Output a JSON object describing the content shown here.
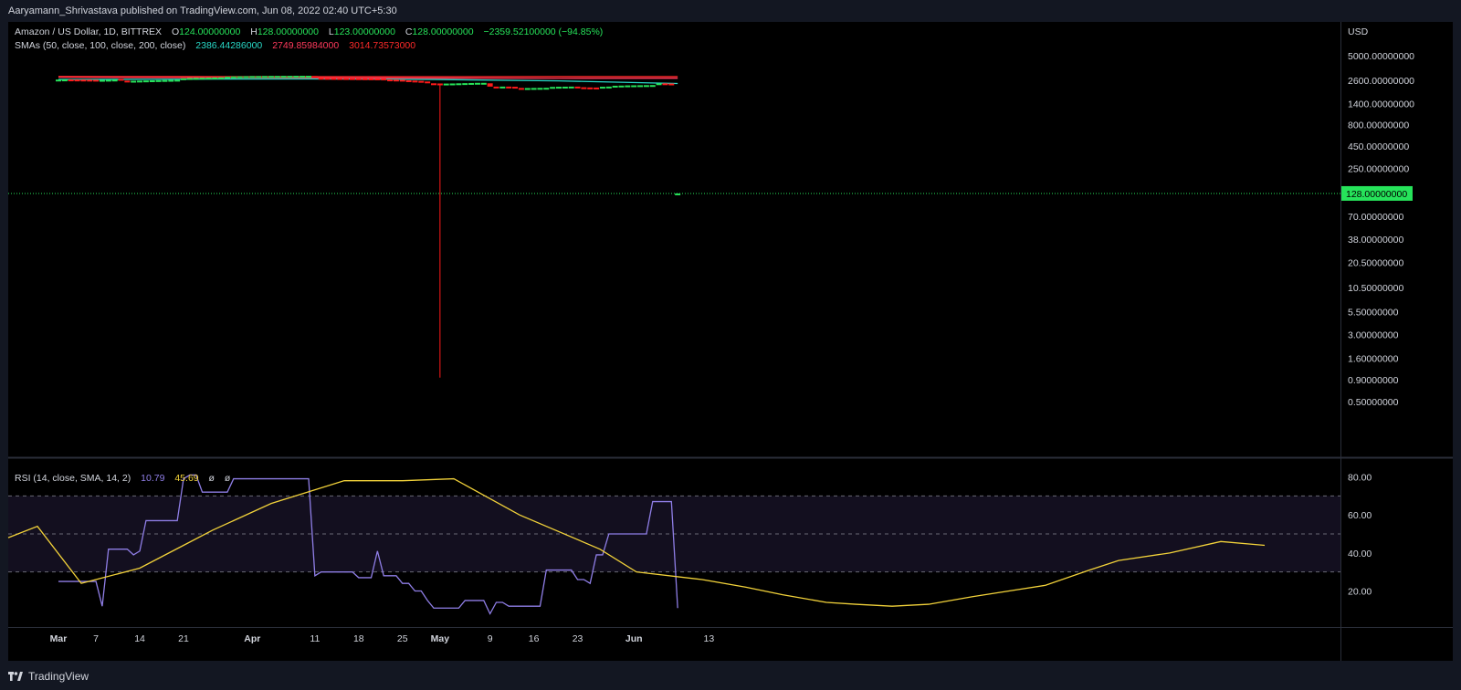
{
  "header": {
    "published": "Aaryamann_Shrivastava published on TradingView.com, Jun 08, 2022 02:40 UTC+5:30"
  },
  "legend": {
    "symbol": "Amazon / US Dollar, 1D, BITTREX",
    "o_label": "O",
    "o_value": "124.00000000",
    "h_label": "H",
    "h_value": "128.00000000",
    "l_label": "L",
    "l_value": "123.00000000",
    "c_label": "C",
    "c_value": "128.00000000",
    "change": "−2359.52100000 (−94.85%)",
    "sma_label": "SMAs (50, close, 100, close, 200, close)",
    "sma50": "2386.44286000",
    "sma100": "2749.85984000",
    "sma200": "3014.73573000",
    "rsi_label": "RSI (14, close, SMA, 14, 2)",
    "rsi_value": "10.79",
    "rsi_ma": "45.69",
    "rsi_x1": "ø",
    "rsi_x2": "ø"
  },
  "footer": {
    "brand": "TradingView"
  },
  "colors": {
    "up": "#26e35a",
    "down": "#ff1a1a",
    "sma50": "#28d9c7",
    "sma100": "#ff3a5c",
    "sma200": "#ff2a2a",
    "rsi": "#8f7ee6",
    "rsi_ma": "#f2d23a"
  },
  "chart_data": [
    {
      "type": "candlestick",
      "scale": "log",
      "currency": "USD",
      "price_ticks": [
        "5000.00000000",
        "2600.00000000",
        "1400.00000000",
        "800.00000000",
        "450.00000000",
        "250.00000000",
        "128.00000000",
        "70.00000000",
        "38.00000000",
        "20.50000000",
        "10.50000000",
        "5.50000000",
        "3.00000000",
        "1.60000000",
        "0.90000000",
        "0.50000000"
      ],
      "last_price": "128.00000000",
      "last_price_value": 128,
      "date_ticks": [
        "Mar",
        "7",
        "14",
        "21",
        "Apr",
        "11",
        "18",
        "25",
        "May",
        "9",
        "16",
        "23",
        "Jun",
        "13"
      ],
      "date_tick_days": [
        0,
        6,
        13,
        20,
        31,
        41,
        48,
        55,
        61,
        69,
        76,
        83,
        92,
        104
      ],
      "candles": [
        {
          "d": 0,
          "o": 2650,
          "c": 2650
        },
        {
          "d": 1,
          "o": 2650,
          "c": 2660
        },
        {
          "d": 2,
          "o": 2660,
          "c": 2655
        },
        {
          "d": 3,
          "o": 2655,
          "c": 2650
        },
        {
          "d": 4,
          "o": 2650,
          "c": 2645
        },
        {
          "d": 5,
          "o": 2645,
          "c": 2640
        },
        {
          "d": 6,
          "o": 2640,
          "c": 2630
        },
        {
          "d": 7,
          "o": 2630,
          "c": 2630
        },
        {
          "d": 8,
          "o": 2630,
          "c": 2640
        },
        {
          "d": 9,
          "o": 2640,
          "c": 2650
        },
        {
          "d": 10,
          "o": 2700,
          "c": 2580
        },
        {
          "d": 11,
          "o": 2580,
          "c": 2560
        },
        {
          "d": 12,
          "o": 2560,
          "c": 2570
        },
        {
          "d": 13,
          "o": 2570,
          "c": 2580
        },
        {
          "d": 14,
          "o": 2580,
          "c": 2590
        },
        {
          "d": 15,
          "o": 2590,
          "c": 2600
        },
        {
          "d": 16,
          "o": 2600,
          "c": 2610
        },
        {
          "d": 17,
          "o": 2610,
          "c": 2620
        },
        {
          "d": 18,
          "o": 2620,
          "c": 2630
        },
        {
          "d": 19,
          "o": 2630,
          "c": 2640
        },
        {
          "d": 20,
          "o": 2650,
          "c": 2740
        },
        {
          "d": 21,
          "o": 2740,
          "c": 2760
        },
        {
          "d": 22,
          "o": 2760,
          "c": 2770
        },
        {
          "d": 23,
          "o": 2770,
          "c": 2780
        },
        {
          "d": 24,
          "o": 2780,
          "c": 2790
        },
        {
          "d": 25,
          "o": 2790,
          "c": 2800
        },
        {
          "d": 26,
          "o": 2800,
          "c": 2810
        },
        {
          "d": 27,
          "o": 2810,
          "c": 2860
        },
        {
          "d": 28,
          "o": 2860,
          "c": 2880
        },
        {
          "d": 29,
          "o": 2880,
          "c": 2890
        },
        {
          "d": 30,
          "o": 2890,
          "c": 2900
        },
        {
          "d": 31,
          "o": 2900,
          "c": 2910
        },
        {
          "d": 32,
          "o": 2910,
          "c": 2910
        },
        {
          "d": 33,
          "o": 2910,
          "c": 2915
        },
        {
          "d": 34,
          "o": 2915,
          "c": 2920
        },
        {
          "d": 35,
          "o": 2920,
          "c": 2920
        },
        {
          "d": 36,
          "o": 2920,
          "c": 2925
        },
        {
          "d": 37,
          "o": 2925,
          "c": 2925
        },
        {
          "d": 38,
          "o": 2925,
          "c": 2930
        },
        {
          "d": 39,
          "o": 2930,
          "c": 2930
        },
        {
          "d": 40,
          "o": 2930,
          "c": 2930
        },
        {
          "d": 41,
          "o": 2920,
          "c": 2780
        },
        {
          "d": 42,
          "o": 2780,
          "c": 2770
        },
        {
          "d": 43,
          "o": 2770,
          "c": 2765
        },
        {
          "d": 44,
          "o": 2765,
          "c": 2760
        },
        {
          "d": 45,
          "o": 2760,
          "c": 2755
        },
        {
          "d": 46,
          "o": 2755,
          "c": 2750
        },
        {
          "d": 47,
          "o": 2750,
          "c": 2745
        },
        {
          "d": 48,
          "o": 2745,
          "c": 2740
        },
        {
          "d": 49,
          "o": 2740,
          "c": 2735
        },
        {
          "d": 50,
          "o": 2735,
          "c": 2730
        },
        {
          "d": 51,
          "o": 2730,
          "c": 2725
        },
        {
          "d": 52,
          "o": 2725,
          "c": 2660
        },
        {
          "d": 53,
          "o": 2660,
          "c": 2650
        },
        {
          "d": 54,
          "o": 2650,
          "c": 2640
        },
        {
          "d": 55,
          "o": 2640,
          "c": 2600
        },
        {
          "d": 56,
          "o": 2600,
          "c": 2580
        },
        {
          "d": 57,
          "o": 2580,
          "c": 2560
        },
        {
          "d": 58,
          "o": 2560,
          "c": 2520
        },
        {
          "d": 59,
          "o": 2520,
          "c": 2400
        },
        {
          "d": 60,
          "o": 2400,
          "c": 2390
        },
        {
          "d": 61,
          "o": 2390,
          "c": 2380,
          "l": 0.95
        },
        {
          "d": 62,
          "o": 2380,
          "c": 2385
        },
        {
          "d": 63,
          "o": 2385,
          "c": 2390
        },
        {
          "d": 64,
          "o": 2390,
          "c": 2400
        },
        {
          "d": 65,
          "o": 2400,
          "c": 2410
        },
        {
          "d": 66,
          "o": 2410,
          "c": 2420
        },
        {
          "d": 67,
          "o": 2420,
          "c": 2430
        },
        {
          "d": 68,
          "o": 2430,
          "c": 2430
        },
        {
          "d": 69,
          "o": 2400,
          "c": 2200
        },
        {
          "d": 70,
          "o": 2200,
          "c": 2190
        },
        {
          "d": 71,
          "o": 2190,
          "c": 2200
        },
        {
          "d": 72,
          "o": 2200,
          "c": 2190
        },
        {
          "d": 73,
          "o": 2190,
          "c": 2120
        },
        {
          "d": 74,
          "o": 2120,
          "c": 2110
        },
        {
          "d": 75,
          "o": 2110,
          "c": 2115
        },
        {
          "d": 76,
          "o": 2115,
          "c": 2120
        },
        {
          "d": 77,
          "o": 2120,
          "c": 2125
        },
        {
          "d": 78,
          "o": 2125,
          "c": 2130
        },
        {
          "d": 79,
          "o": 2130,
          "c": 2180
        },
        {
          "d": 80,
          "o": 2180,
          "c": 2190
        },
        {
          "d": 81,
          "o": 2190,
          "c": 2195
        },
        {
          "d": 82,
          "o": 2195,
          "c": 2200
        },
        {
          "d": 83,
          "o": 2200,
          "c": 2160
        },
        {
          "d": 84,
          "o": 2160,
          "c": 2150
        },
        {
          "d": 85,
          "o": 2150,
          "c": 2145
        },
        {
          "d": 86,
          "o": 2145,
          "c": 2140
        },
        {
          "d": 87,
          "o": 2140,
          "c": 2190
        },
        {
          "d": 88,
          "o": 2190,
          "c": 2200
        },
        {
          "d": 89,
          "o": 2200,
          "c": 2250
        },
        {
          "d": 90,
          "o": 2250,
          "c": 2260
        },
        {
          "d": 91,
          "o": 2260,
          "c": 2270
        },
        {
          "d": 92,
          "o": 2270,
          "c": 2275
        },
        {
          "d": 93,
          "o": 2275,
          "c": 2280
        },
        {
          "d": 94,
          "o": 2280,
          "c": 2285
        },
        {
          "d": 95,
          "o": 2285,
          "c": 2290
        },
        {
          "d": 96,
          "o": 2290,
          "c": 2400
        },
        {
          "d": 97,
          "o": 2400,
          "c": 2390
        },
        {
          "d": 98,
          "o": 2390,
          "c": 2380
        },
        {
          "d": 99,
          "o": 124,
          "c": 128
        }
      ],
      "sma": [
        {
          "name": "SMA 50",
          "points": [
            [
              0,
              2660
            ],
            [
              20,
              2680
            ],
            [
              40,
              2700
            ],
            [
              60,
              2660
            ],
            [
              80,
              2560
            ],
            [
              99,
              2386
            ]
          ]
        },
        {
          "name": "SMA 100",
          "points": [
            [
              0,
              2820
            ],
            [
              20,
              2800
            ],
            [
              40,
              2790
            ],
            [
              60,
              2760
            ],
            [
              80,
              2740
            ],
            [
              99,
              2750
            ]
          ]
        },
        {
          "name": "SMA 200",
          "points": [
            [
              0,
              2880
            ],
            [
              20,
              2870
            ],
            [
              40,
              2860
            ],
            [
              60,
              2860
            ],
            [
              80,
              2870
            ],
            [
              99,
              2870
            ]
          ]
        }
      ]
    },
    {
      "type": "line",
      "ticks": [
        "80.00",
        "60.00",
        "40.00",
        "20.00"
      ],
      "ylim": [
        0,
        88
      ],
      "bands": [
        30,
        50,
        70
      ],
      "rsi": [
        [
          0,
          25
        ],
        [
          1,
          25
        ],
        [
          2,
          25
        ],
        [
          3,
          25
        ],
        [
          4,
          25
        ],
        [
          5,
          25
        ],
        [
          6,
          25
        ],
        [
          7,
          12
        ],
        [
          8,
          42
        ],
        [
          9,
          42
        ],
        [
          10,
          42
        ],
        [
          11,
          42
        ],
        [
          12,
          39
        ],
        [
          13,
          41
        ],
        [
          14,
          57
        ],
        [
          15,
          57
        ],
        [
          16,
          57
        ],
        [
          17,
          57
        ],
        [
          18,
          57
        ],
        [
          19,
          57
        ],
        [
          20,
          79
        ],
        [
          21,
          81
        ],
        [
          22,
          81
        ],
        [
          23,
          72
        ],
        [
          24,
          72
        ],
        [
          25,
          72
        ],
        [
          26,
          72
        ],
        [
          27,
          72
        ],
        [
          28,
          79
        ],
        [
          29,
          79
        ],
        [
          30,
          79
        ],
        [
          31,
          79
        ],
        [
          32,
          79
        ],
        [
          33,
          79
        ],
        [
          34,
          79
        ],
        [
          35,
          79
        ],
        [
          36,
          79
        ],
        [
          37,
          79
        ],
        [
          38,
          79
        ],
        [
          39,
          79
        ],
        [
          40,
          79
        ],
        [
          41,
          28
        ],
        [
          42,
          30
        ],
        [
          43,
          30
        ],
        [
          44,
          30
        ],
        [
          45,
          30
        ],
        [
          46,
          30
        ],
        [
          47,
          30
        ],
        [
          48,
          27
        ],
        [
          49,
          27
        ],
        [
          50,
          27
        ],
        [
          51,
          41
        ],
        [
          52,
          28
        ],
        [
          53,
          28
        ],
        [
          54,
          28
        ],
        [
          55,
          24
        ],
        [
          56,
          24
        ],
        [
          57,
          20
        ],
        [
          58,
          20
        ],
        [
          59,
          15
        ],
        [
          60,
          11
        ],
        [
          61,
          11
        ],
        [
          62,
          11
        ],
        [
          63,
          11
        ],
        [
          64,
          11
        ],
        [
          65,
          15
        ],
        [
          66,
          15
        ],
        [
          67,
          15
        ],
        [
          68,
          15
        ],
        [
          69,
          8
        ],
        [
          70,
          14
        ],
        [
          71,
          14
        ],
        [
          72,
          12
        ],
        [
          73,
          12
        ],
        [
          74,
          12
        ],
        [
          75,
          12
        ],
        [
          76,
          12
        ],
        [
          77,
          12
        ],
        [
          78,
          31
        ],
        [
          79,
          31
        ],
        [
          80,
          31
        ],
        [
          81,
          31
        ],
        [
          82,
          31
        ],
        [
          83,
          26
        ],
        [
          84,
          26
        ],
        [
          85,
          24
        ],
        [
          86,
          39
        ],
        [
          87,
          39
        ],
        [
          88,
          50
        ],
        [
          89,
          50
        ],
        [
          90,
          50
        ],
        [
          91,
          50
        ],
        [
          92,
          50
        ],
        [
          93,
          50
        ],
        [
          94,
          50
        ],
        [
          95,
          67
        ],
        [
          96,
          67
        ],
        [
          97,
          67
        ],
        [
          98,
          67
        ],
        [
          99,
          11
        ]
      ],
      "rsi_ma": [
        [
          0,
          48
        ],
        [
          4,
          54
        ],
        [
          10,
          24
        ],
        [
          18,
          32
        ],
        [
          24,
          44
        ],
        [
          28,
          52
        ],
        [
          36,
          66
        ],
        [
          46,
          78
        ],
        [
          54,
          78
        ],
        [
          61,
          79
        ],
        [
          70,
          60
        ],
        [
          81,
          42
        ],
        [
          86,
          30
        ],
        [
          95,
          26
        ],
        [
          101,
          22
        ],
        [
          106,
          18
        ],
        [
          112,
          14
        ],
        [
          116,
          13
        ],
        [
          121,
          12
        ],
        [
          126,
          13
        ],
        [
          132,
          17
        ],
        [
          137,
          20
        ],
        [
          142,
          23
        ],
        [
          148,
          31
        ],
        [
          152,
          36
        ],
        [
          159,
          40
        ],
        [
          166,
          46
        ],
        [
          172,
          44
        ]
      ]
    }
  ]
}
